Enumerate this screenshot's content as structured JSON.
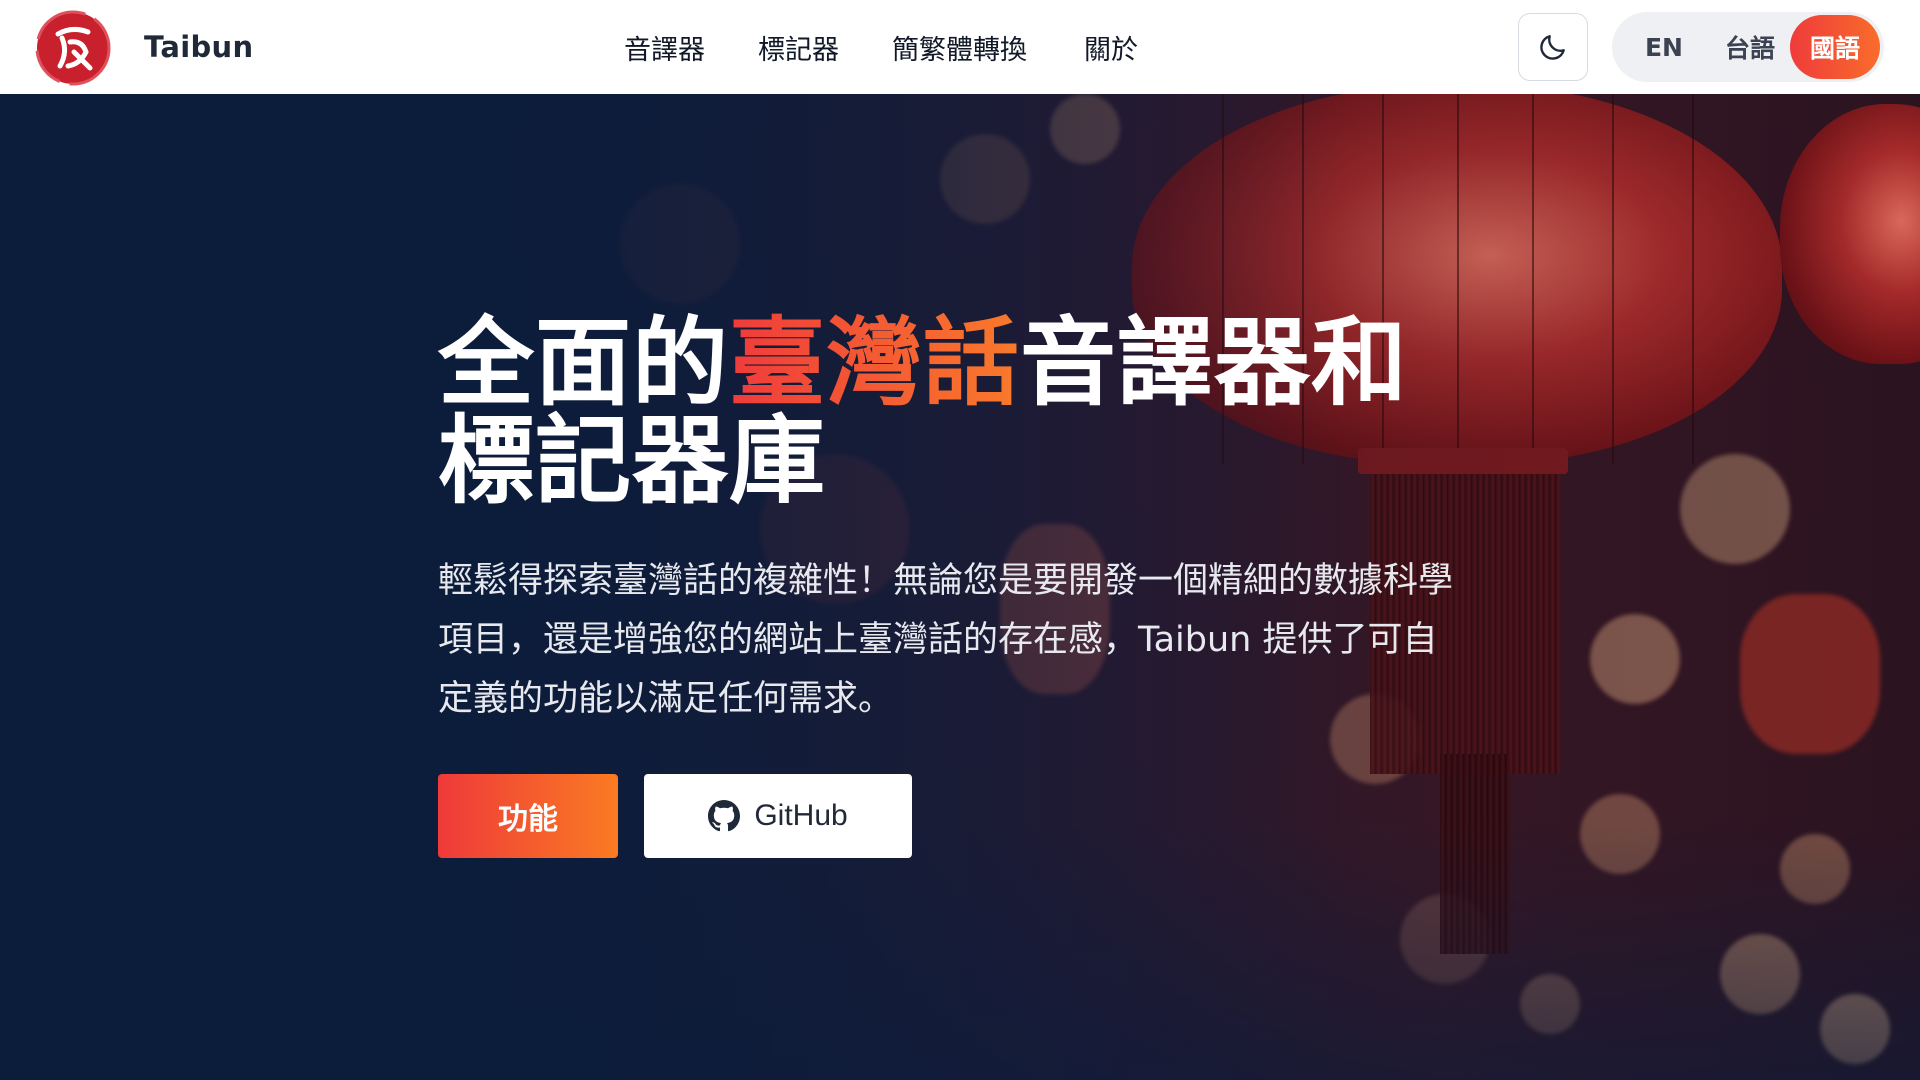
{
  "header": {
    "brand": "Taibun",
    "nav": {
      "transliterator": "音譯器",
      "tokenizer": "標記器",
      "converter": "簡繁體轉換",
      "about": "關於"
    },
    "theme_icon": "moon-icon",
    "languages": {
      "en": "EN",
      "taigi": "台語",
      "mandarin": "國語",
      "active": "國語"
    }
  },
  "hero": {
    "title_before": "全面的",
    "title_accent": "臺灣話",
    "title_after": "音譯器和標記器庫",
    "description": "輕鬆得探索臺灣話的複雜性！無論您是要開發一個精細的數據科學項目，還是增強您的網站上臺灣話的存在感，Taibun 提供了可自定義的功能以滿足任何需求。",
    "primary_button": "功能",
    "secondary_button": "GitHub",
    "secondary_icon": "github-icon"
  },
  "colors": {
    "accent_start": "#ef3b3b",
    "accent_end": "#f97a2b",
    "hero_bg": "#0c1c3b",
    "header_bg": "#ffffff"
  }
}
